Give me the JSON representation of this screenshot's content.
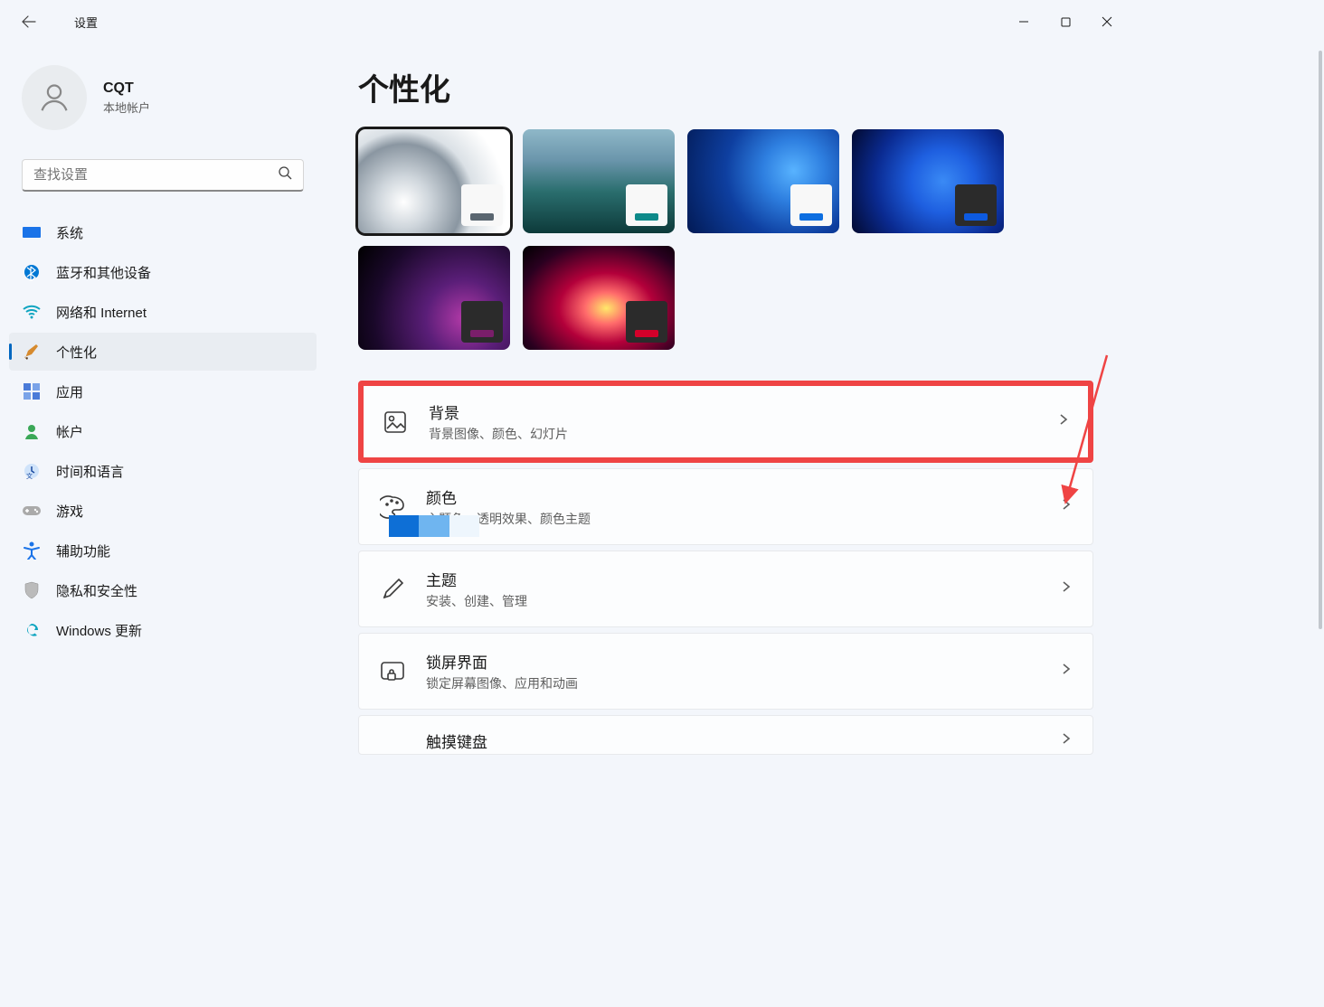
{
  "app_title": "设置",
  "window_controls": {
    "min": "—",
    "max": "☐",
    "close": "✕"
  },
  "user": {
    "name": "CQT",
    "sub": "本地帐户"
  },
  "search": {
    "placeholder": "查找设置"
  },
  "nav": [
    {
      "icon": "🖥️",
      "label": "系统",
      "active": false,
      "color": "#1a73e8"
    },
    {
      "icon": "bt",
      "label": "蓝牙和其他设备",
      "active": false,
      "color": "#0078d4"
    },
    {
      "icon": "wifi",
      "label": "网络和 Internet",
      "active": false,
      "color": "#0fa5c0"
    },
    {
      "icon": "brush",
      "label": "个性化",
      "active": true,
      "color": "#d68a2e"
    },
    {
      "icon": "apps",
      "label": "应用",
      "active": false,
      "color": "#4a7bd8"
    },
    {
      "icon": "person",
      "label": "帐户",
      "active": false,
      "color": "#3aa757"
    },
    {
      "icon": "clock",
      "label": "时间和语言",
      "active": false,
      "color": "#3a6ed8"
    },
    {
      "icon": "game",
      "label": "游戏",
      "active": false,
      "color": "#888"
    },
    {
      "icon": "access",
      "label": "辅助功能",
      "active": false,
      "color": "#1a73e8"
    },
    {
      "icon": "shield",
      "label": "隐私和安全性",
      "active": false,
      "color": "#888"
    },
    {
      "icon": "update",
      "label": "Windows 更新",
      "active": false,
      "color": "#0fa5c0"
    }
  ],
  "page_title": "个性化",
  "themes": [
    {
      "bg": "bg-t1",
      "accent": "#5a6670",
      "mini_dark": false,
      "selected": true
    },
    {
      "bg": "bg-t2",
      "accent": "#0e8a8a",
      "mini_dark": false,
      "selected": false
    },
    {
      "bg": "bg-t3",
      "accent": "#0d6ee0",
      "mini_dark": false,
      "selected": false
    },
    {
      "bg": "bg-t4",
      "accent": "#0d5ae0",
      "mini_dark": true,
      "selected": false
    },
    {
      "bg": "bg-t5",
      "accent": "#7a1e6a",
      "mini_dark": true,
      "selected": false
    },
    {
      "bg": "bg-t6",
      "accent": "#d4002a",
      "mini_dark": true,
      "selected": false
    }
  ],
  "cards": [
    {
      "id": "background",
      "title": "背景",
      "sub": "背景图像、颜色、幻灯片",
      "highlight": true
    },
    {
      "id": "colors",
      "title": "颜色",
      "sub": "主题色、透明效果、颜色主题",
      "highlight": false
    },
    {
      "id": "themes",
      "title": "主题",
      "sub": "安装、创建、管理",
      "highlight": false
    },
    {
      "id": "lockscreen",
      "title": "锁屏界面",
      "sub": "锁定屏幕图像、应用和动画",
      "highlight": false
    },
    {
      "id": "touchkb",
      "title": "触摸键盘",
      "sub": "",
      "highlight": false
    }
  ]
}
